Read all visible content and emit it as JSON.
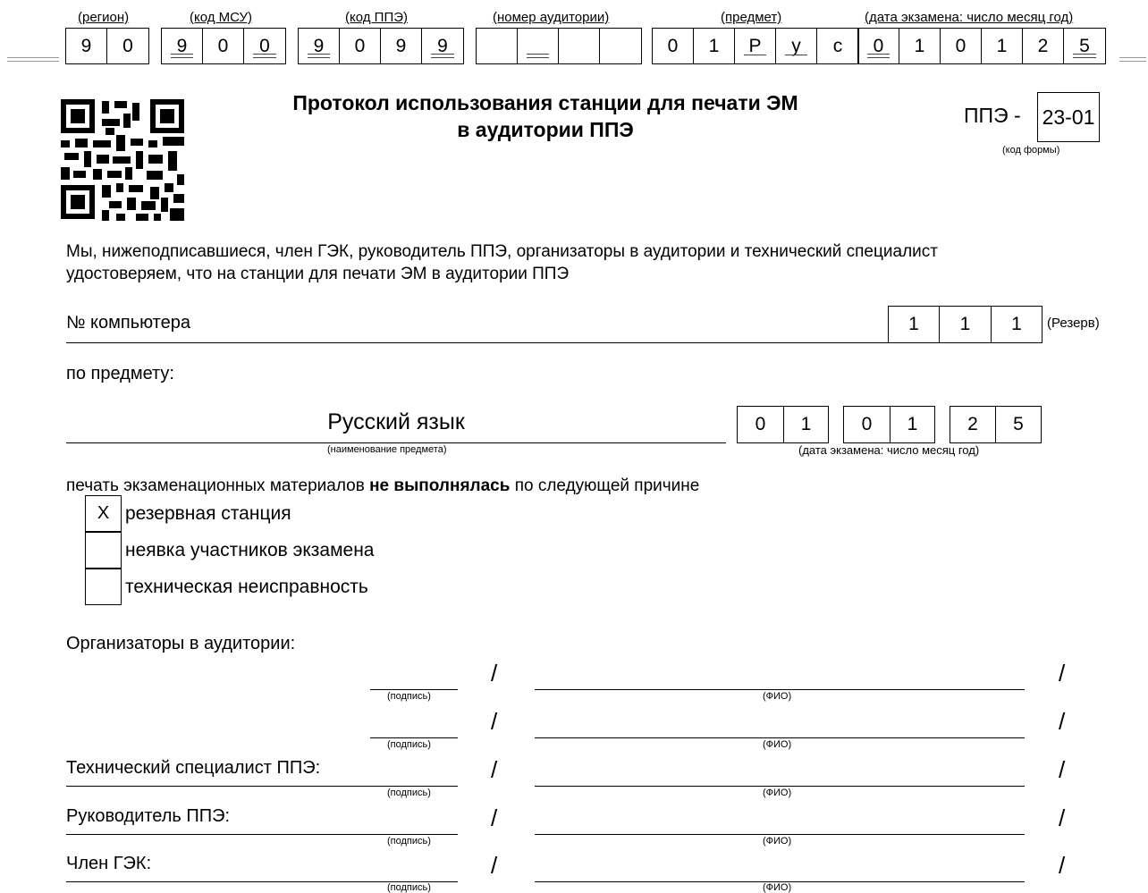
{
  "header": {
    "labels": {
      "region": "(регион)",
      "msu": "(код МСУ)",
      "ppe": "(код ППЭ)",
      "room": "(номер аудитории)",
      "subject": "(предмет)",
      "date": "(дата экзамена: число месяц год)"
    },
    "region": [
      "9",
      "0"
    ],
    "msu": [
      "9",
      "0",
      "0"
    ],
    "ppe": [
      "9",
      "0",
      "9",
      "9"
    ],
    "room": [
      "",
      "",
      "",
      ""
    ],
    "subject": [
      "0",
      "1",
      "Р",
      "у",
      "с"
    ],
    "date": [
      "0",
      "1",
      "0",
      "1",
      "2",
      "5"
    ]
  },
  "title_line1": "Протокол использования станции для печати ЭМ",
  "title_line2": "в аудитории ППЭ",
  "form_code": {
    "prefix": "ППЭ -",
    "code": "23-01",
    "caption": "(код формы)"
  },
  "intro_line1": "Мы, нижеподписавшиеся, член ГЭК, руководитель ППЭ, организаторы в аудитории и технический специалист",
  "intro_line2": "удостоверяем, что на станции для печати ЭМ в аудитории ППЭ",
  "computer": {
    "label": "№ компьютера",
    "digits": [
      "1",
      "1",
      "1"
    ],
    "note": "(Резерв)"
  },
  "subject_label": "по предмету:",
  "subject_name": "Русский язык",
  "subject_caption": "(наименование предмета)",
  "exam_date": {
    "groups": [
      [
        "0",
        "1"
      ],
      [
        "0",
        "1"
      ],
      [
        "2",
        "5"
      ]
    ],
    "caption": "(дата экзамена: число месяц год)"
  },
  "reason_prefix": "печать экзаменационных материалов ",
  "reason_bold": "не выполнялась",
  "reason_suffix": " по следующей причине",
  "reasons": [
    {
      "mark": "X",
      "label": "резервная станция"
    },
    {
      "mark": "",
      "label": "неявка участников экзамена"
    },
    {
      "mark": "",
      "label": "техническая неисправность"
    }
  ],
  "signatures": {
    "organizers_label": "Организаторы в аудитории:",
    "tech_label": "Технический специалист ППЭ:",
    "head_label": "Руководитель ППЭ:",
    "gek_label": "Член ГЭК:",
    "sign_caption": "(подпись)",
    "fio_caption": "(ФИО)",
    "slash": "/"
  }
}
